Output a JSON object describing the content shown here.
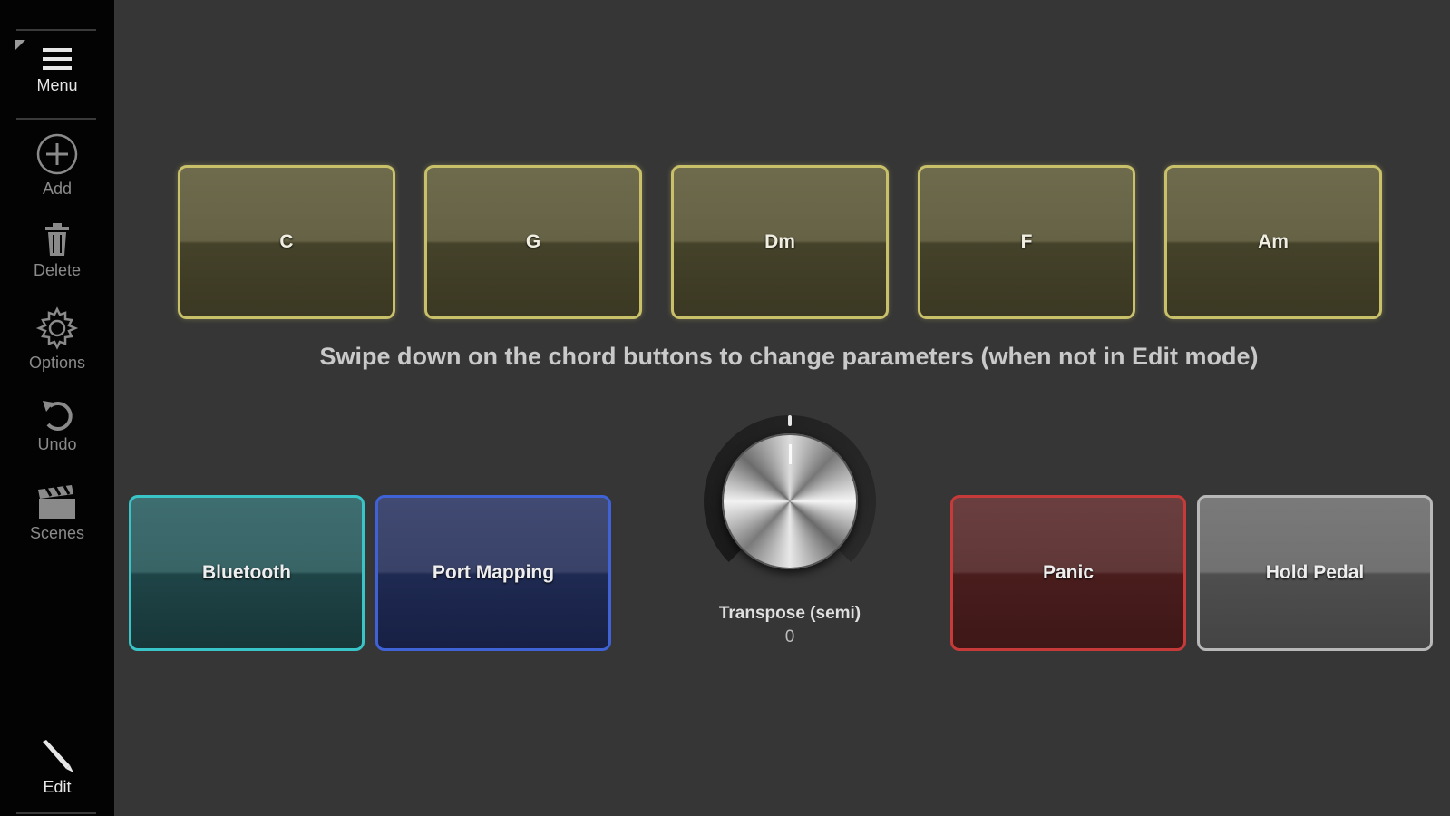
{
  "sidebar": {
    "menu": {
      "label": "Menu",
      "icon": "hamburger-icon"
    },
    "add": {
      "label": "Add",
      "icon": "plus-circle-icon"
    },
    "delete": {
      "label": "Delete",
      "icon": "trash-icon"
    },
    "options": {
      "label": "Options",
      "icon": "gear-icon"
    },
    "undo": {
      "label": "Undo",
      "icon": "undo-icon"
    },
    "scenes": {
      "label": "Scenes",
      "icon": "clapperboard-icon"
    },
    "edit": {
      "label": "Edit",
      "icon": "pencil-icon"
    }
  },
  "chords": [
    "C",
    "G",
    "Dm",
    "F",
    "Am"
  ],
  "hint": "Swipe down on the chord buttons to change parameters (when not in Edit mode)",
  "pads": {
    "bluetooth": "Bluetooth",
    "port_mapping": "Port Mapping",
    "panic": "Panic",
    "hold_pedal": "Hold Pedal"
  },
  "transpose": {
    "label": "Transpose (semi)",
    "value": "0"
  },
  "colors": {
    "chord_border": "#c9c06a",
    "bluetooth": "#39c5c8",
    "port_mapping": "#3f63d6",
    "panic": "#c63a3a",
    "hold_pedal": "#b8b8b8"
  }
}
